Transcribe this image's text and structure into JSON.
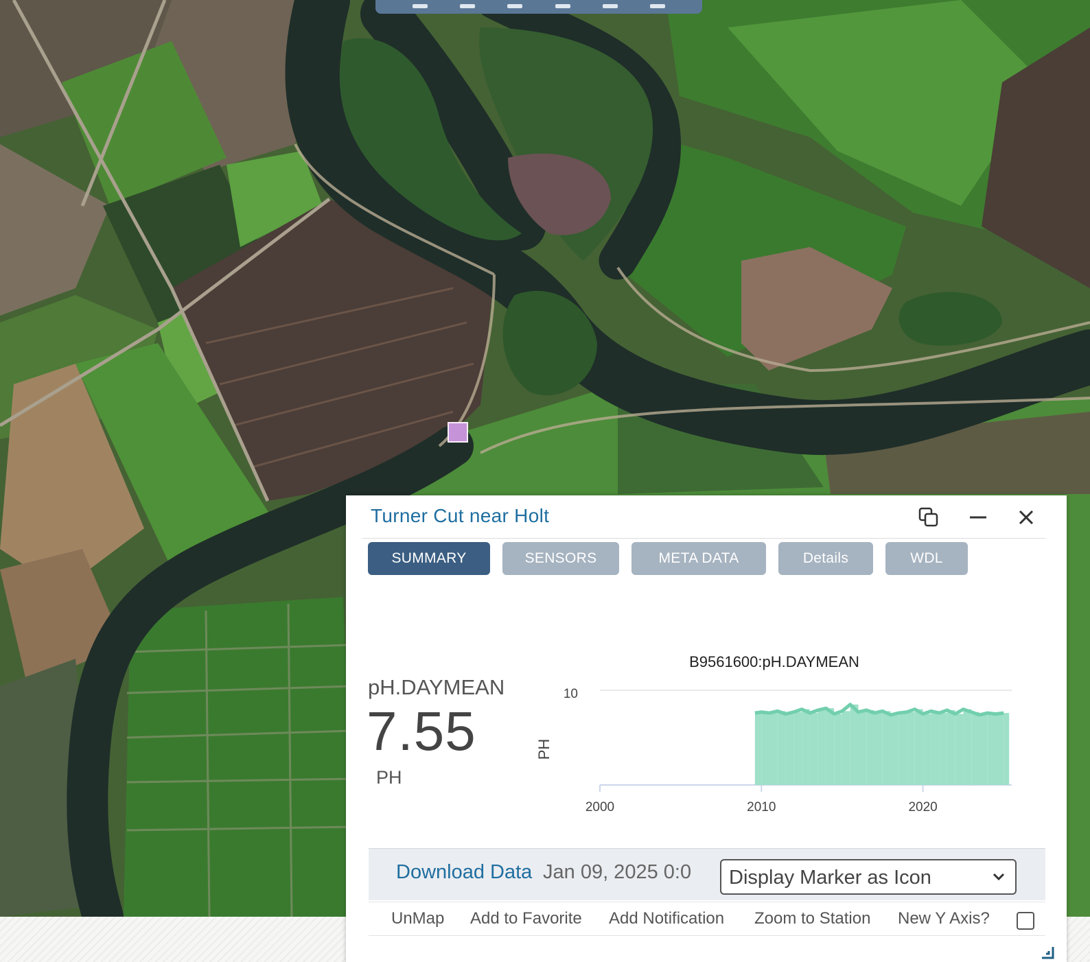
{
  "map": {
    "marker_color": "#c593d7",
    "water_color": "#1f2e29"
  },
  "panel": {
    "title": "Turner Cut near Holt",
    "controls": {
      "restore": "restore-window-icon",
      "minimize": "minimize-icon",
      "close": "close-icon"
    },
    "tabs": [
      {
        "label": "SUMMARY",
        "active": true
      },
      {
        "label": "SENSORS",
        "active": false
      },
      {
        "label": "META DATA",
        "active": false
      },
      {
        "label": "Details",
        "active": false
      },
      {
        "label": "WDL",
        "active": false
      }
    ],
    "metric": {
      "name": "pH.DAYMEAN",
      "value": "7.55",
      "unit": "PH"
    },
    "actions": {
      "download_label": "Download Data",
      "date": "Jan 09, 2025 0:0",
      "marker_select": {
        "selected": "Display Marker as Icon"
      }
    },
    "links": [
      "UnMap",
      "Add to Favorite",
      "Add Notification",
      "Zoom to Station",
      "New Y Axis?"
    ],
    "new_y_axis_checked": false
  },
  "chart_data": {
    "type": "area",
    "title": "B9561600:pH.DAYMEAN",
    "xlabel": "",
    "ylabel": "PH",
    "xlim": [
      2000,
      2025.5
    ],
    "ylim": [
      0,
      10
    ],
    "x_ticks": [
      "2000",
      "2010",
      "2020"
    ],
    "y_ticks": [
      "10"
    ],
    "color": "#7fd8bd",
    "series": [
      {
        "x": [
          2009.6,
          2010.0,
          2010.5,
          2011.0,
          2011.5,
          2012.0,
          2012.5,
          2013.0,
          2013.5,
          2014.0,
          2014.5,
          2015.0,
          2015.5,
          2016.0,
          2016.5,
          2017.0,
          2017.5,
          2018.0,
          2018.5,
          2019.0,
          2019.5,
          2020.0,
          2020.5,
          2021.0,
          2021.5,
          2022.0,
          2022.5,
          2023.0,
          2023.5,
          2024.0,
          2024.5,
          2025.0
        ],
        "y": [
          7.6,
          7.7,
          7.6,
          7.8,
          7.5,
          7.7,
          8.0,
          7.6,
          7.9,
          8.1,
          7.5,
          7.8,
          8.5,
          7.7,
          7.9,
          7.6,
          7.8,
          7.4,
          7.6,
          7.7,
          8.0,
          7.5,
          7.8,
          7.6,
          7.9,
          7.5,
          8.0,
          7.7,
          7.4,
          7.6,
          7.5,
          7.6
        ]
      }
    ]
  }
}
